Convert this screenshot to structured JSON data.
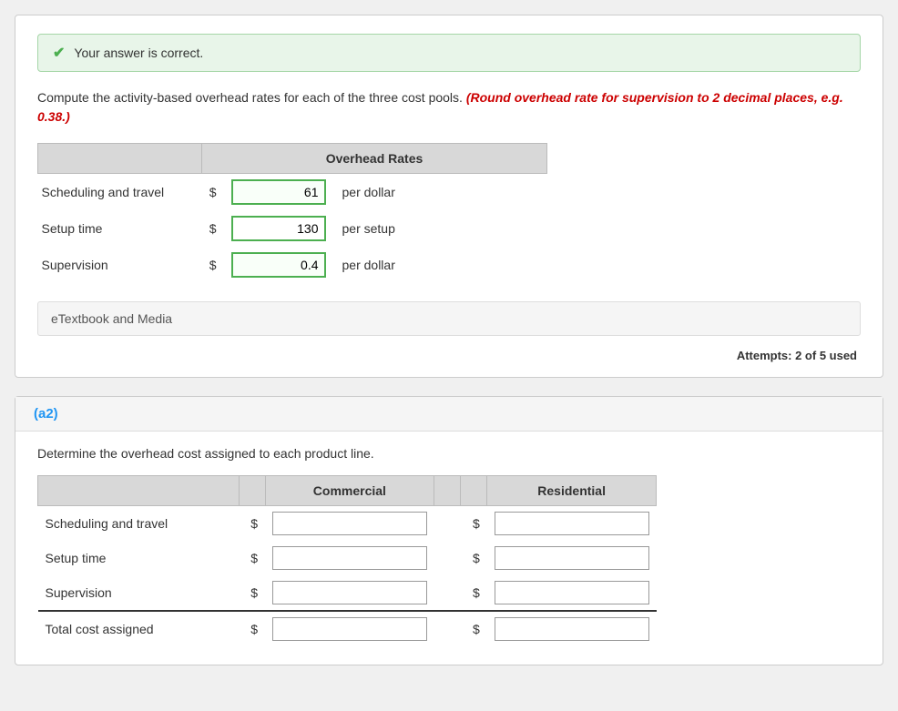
{
  "correct_banner": {
    "text": "Your answer is correct."
  },
  "instruction": {
    "text": "Compute the activity-based overhead rates for each of the three cost pools.",
    "highlight": "(Round overhead rate for supervision to 2 decimal places, e.g. 0.38.)"
  },
  "overhead_table": {
    "header": "Overhead Rates",
    "rows": [
      {
        "label": "Scheduling and travel",
        "dollar": "$",
        "value": "61",
        "unit": "per dollar"
      },
      {
        "label": "Setup time",
        "dollar": "$",
        "value": "130",
        "unit": "per setup"
      },
      {
        "label": "Supervision",
        "dollar": "$",
        "value": "0.4",
        "unit": "per dollar"
      }
    ]
  },
  "etextbook": {
    "label": "eTextbook and Media"
  },
  "attempts": {
    "text": "Attempts: 2 of 5 used"
  },
  "section_a2": {
    "label": "(a2)",
    "instruction": "Determine the overhead cost assigned to each product line.",
    "table": {
      "col_commercial": "Commercial",
      "col_residential": "Residential",
      "rows": [
        {
          "label": "Scheduling and travel"
        },
        {
          "label": "Setup time"
        },
        {
          "label": "Supervision"
        },
        {
          "label": "Total cost assigned",
          "is_total": true
        }
      ]
    }
  }
}
